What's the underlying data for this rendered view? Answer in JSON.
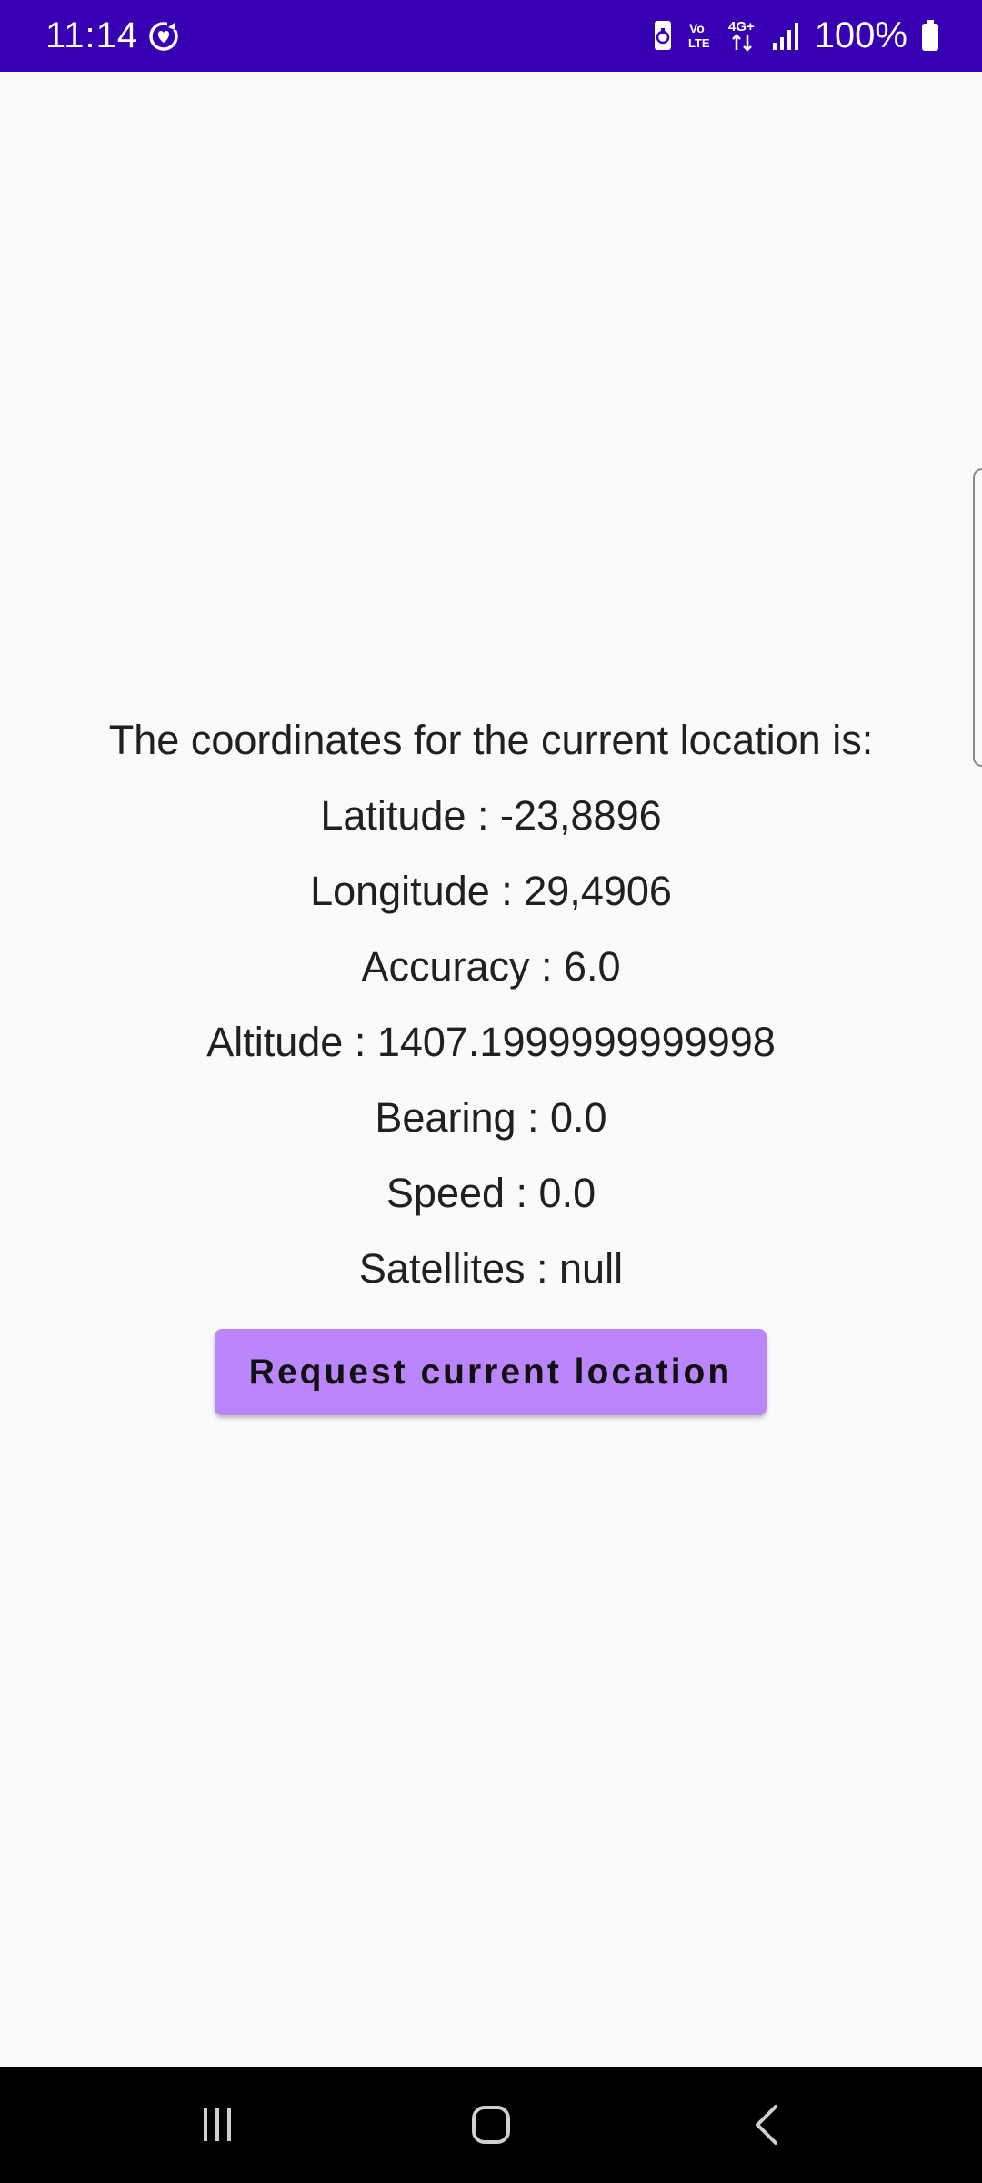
{
  "status_bar": {
    "time": "11:14",
    "battery": "100%",
    "icons": [
      "sync-heart-icon",
      "battery-saver-icon",
      "volte-icon",
      "4g-plus-icon",
      "signal-icon",
      "battery-icon"
    ],
    "background_color": "#3700b3"
  },
  "location_info": {
    "heading": "The coordinates for the current location is:",
    "latitude": "Latitude : -23,8896",
    "longitude": "Longitude : 29,4906",
    "accuracy": "Accuracy : 6.0",
    "altitude": "Altitude : 1407.1999999999998",
    "bearing": "Bearing : 0.0",
    "speed": "Speed : 0.0",
    "satellites": "Satellites : null"
  },
  "actions": {
    "request_button_label": "Request current location",
    "button_color": "#bb86fc"
  },
  "nav_bar": {
    "icons": [
      "recents-icon",
      "home-icon",
      "back-icon"
    ]
  }
}
